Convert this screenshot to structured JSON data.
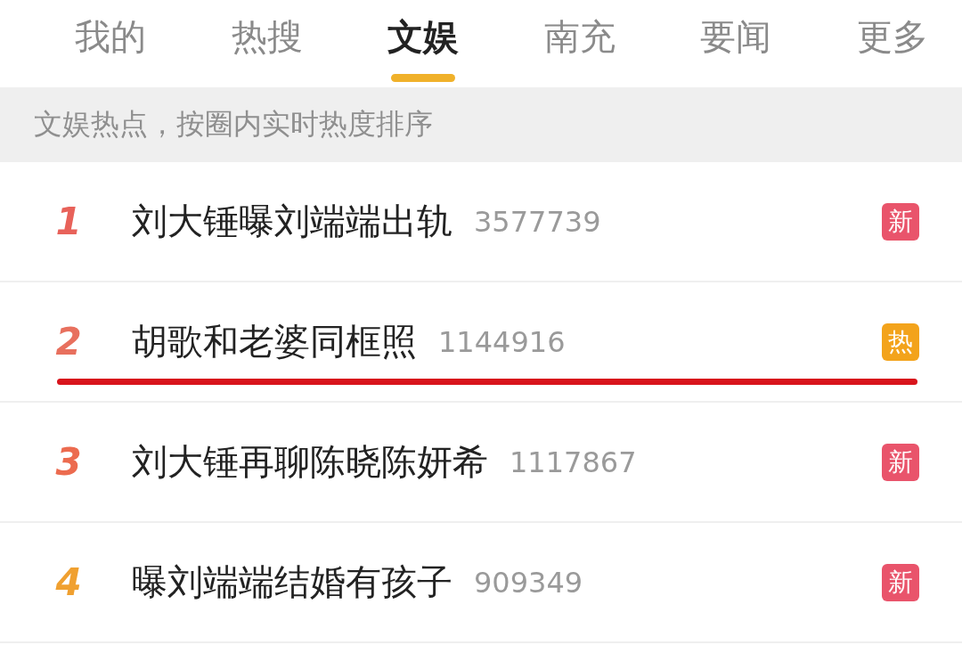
{
  "tabs": [
    {
      "label": "我的",
      "selected": false
    },
    {
      "label": "热搜",
      "selected": false
    },
    {
      "label": "文娱",
      "selected": true
    },
    {
      "label": "南充",
      "selected": false
    },
    {
      "label": "要闻",
      "selected": false
    },
    {
      "label": "更多",
      "selected": false
    }
  ],
  "banner": "文娱热点，按圈内实时热度排序",
  "rows": [
    {
      "rank": "1",
      "color": "#e8625a",
      "title": "刘大锤曝刘端端出轨",
      "count": "3577739",
      "badge": {
        "kind": "new",
        "text": "新"
      },
      "underlined": false
    },
    {
      "rank": "2",
      "color": "#e8705e",
      "title": "胡歌和老婆同框照",
      "count": "1144916",
      "badge": {
        "kind": "hot",
        "text": "热"
      },
      "underlined": true
    },
    {
      "rank": "3",
      "color": "#ec6b4f",
      "title": "刘大锤再聊陈晓陈妍希",
      "count": "1117867",
      "badge": {
        "kind": "new",
        "text": "新"
      },
      "underlined": false
    },
    {
      "rank": "4",
      "color": "#f0a030",
      "title": "曝刘端端结婚有孩子",
      "count": "909349",
      "badge": {
        "kind": "new",
        "text": "新"
      },
      "underlined": false
    }
  ]
}
